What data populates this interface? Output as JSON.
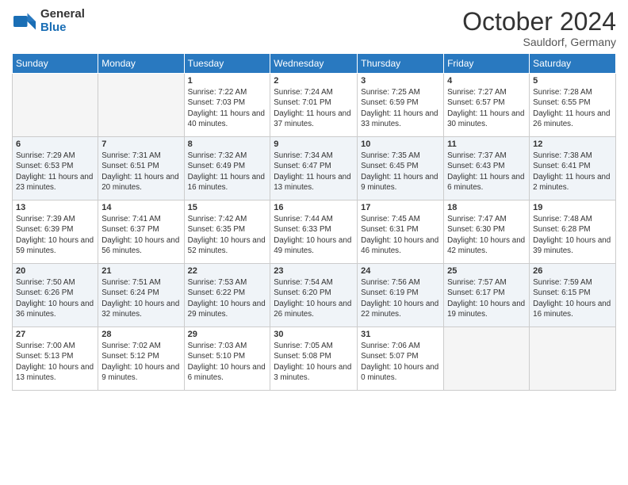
{
  "logo": {
    "general": "General",
    "blue": "Blue"
  },
  "header": {
    "month": "October 2024",
    "location": "Sauldorf, Germany"
  },
  "weekdays": [
    "Sunday",
    "Monday",
    "Tuesday",
    "Wednesday",
    "Thursday",
    "Friday",
    "Saturday"
  ],
  "weeks": [
    [
      {
        "day": "",
        "info": ""
      },
      {
        "day": "",
        "info": ""
      },
      {
        "day": "1",
        "info": "Sunrise: 7:22 AM\nSunset: 7:03 PM\nDaylight: 11 hours and 40 minutes."
      },
      {
        "day": "2",
        "info": "Sunrise: 7:24 AM\nSunset: 7:01 PM\nDaylight: 11 hours and 37 minutes."
      },
      {
        "day": "3",
        "info": "Sunrise: 7:25 AM\nSunset: 6:59 PM\nDaylight: 11 hours and 33 minutes."
      },
      {
        "day": "4",
        "info": "Sunrise: 7:27 AM\nSunset: 6:57 PM\nDaylight: 11 hours and 30 minutes."
      },
      {
        "day": "5",
        "info": "Sunrise: 7:28 AM\nSunset: 6:55 PM\nDaylight: 11 hours and 26 minutes."
      }
    ],
    [
      {
        "day": "6",
        "info": "Sunrise: 7:29 AM\nSunset: 6:53 PM\nDaylight: 11 hours and 23 minutes."
      },
      {
        "day": "7",
        "info": "Sunrise: 7:31 AM\nSunset: 6:51 PM\nDaylight: 11 hours and 20 minutes."
      },
      {
        "day": "8",
        "info": "Sunrise: 7:32 AM\nSunset: 6:49 PM\nDaylight: 11 hours and 16 minutes."
      },
      {
        "day": "9",
        "info": "Sunrise: 7:34 AM\nSunset: 6:47 PM\nDaylight: 11 hours and 13 minutes."
      },
      {
        "day": "10",
        "info": "Sunrise: 7:35 AM\nSunset: 6:45 PM\nDaylight: 11 hours and 9 minutes."
      },
      {
        "day": "11",
        "info": "Sunrise: 7:37 AM\nSunset: 6:43 PM\nDaylight: 11 hours and 6 minutes."
      },
      {
        "day": "12",
        "info": "Sunrise: 7:38 AM\nSunset: 6:41 PM\nDaylight: 11 hours and 2 minutes."
      }
    ],
    [
      {
        "day": "13",
        "info": "Sunrise: 7:39 AM\nSunset: 6:39 PM\nDaylight: 10 hours and 59 minutes."
      },
      {
        "day": "14",
        "info": "Sunrise: 7:41 AM\nSunset: 6:37 PM\nDaylight: 10 hours and 56 minutes."
      },
      {
        "day": "15",
        "info": "Sunrise: 7:42 AM\nSunset: 6:35 PM\nDaylight: 10 hours and 52 minutes."
      },
      {
        "day": "16",
        "info": "Sunrise: 7:44 AM\nSunset: 6:33 PM\nDaylight: 10 hours and 49 minutes."
      },
      {
        "day": "17",
        "info": "Sunrise: 7:45 AM\nSunset: 6:31 PM\nDaylight: 10 hours and 46 minutes."
      },
      {
        "day": "18",
        "info": "Sunrise: 7:47 AM\nSunset: 6:30 PM\nDaylight: 10 hours and 42 minutes."
      },
      {
        "day": "19",
        "info": "Sunrise: 7:48 AM\nSunset: 6:28 PM\nDaylight: 10 hours and 39 minutes."
      }
    ],
    [
      {
        "day": "20",
        "info": "Sunrise: 7:50 AM\nSunset: 6:26 PM\nDaylight: 10 hours and 36 minutes."
      },
      {
        "day": "21",
        "info": "Sunrise: 7:51 AM\nSunset: 6:24 PM\nDaylight: 10 hours and 32 minutes."
      },
      {
        "day": "22",
        "info": "Sunrise: 7:53 AM\nSunset: 6:22 PM\nDaylight: 10 hours and 29 minutes."
      },
      {
        "day": "23",
        "info": "Sunrise: 7:54 AM\nSunset: 6:20 PM\nDaylight: 10 hours and 26 minutes."
      },
      {
        "day": "24",
        "info": "Sunrise: 7:56 AM\nSunset: 6:19 PM\nDaylight: 10 hours and 22 minutes."
      },
      {
        "day": "25",
        "info": "Sunrise: 7:57 AM\nSunset: 6:17 PM\nDaylight: 10 hours and 19 minutes."
      },
      {
        "day": "26",
        "info": "Sunrise: 7:59 AM\nSunset: 6:15 PM\nDaylight: 10 hours and 16 minutes."
      }
    ],
    [
      {
        "day": "27",
        "info": "Sunrise: 7:00 AM\nSunset: 5:13 PM\nDaylight: 10 hours and 13 minutes."
      },
      {
        "day": "28",
        "info": "Sunrise: 7:02 AM\nSunset: 5:12 PM\nDaylight: 10 hours and 9 minutes."
      },
      {
        "day": "29",
        "info": "Sunrise: 7:03 AM\nSunset: 5:10 PM\nDaylight: 10 hours and 6 minutes."
      },
      {
        "day": "30",
        "info": "Sunrise: 7:05 AM\nSunset: 5:08 PM\nDaylight: 10 hours and 3 minutes."
      },
      {
        "day": "31",
        "info": "Sunrise: 7:06 AM\nSunset: 5:07 PM\nDaylight: 10 hours and 0 minutes."
      },
      {
        "day": "",
        "info": ""
      },
      {
        "day": "",
        "info": ""
      }
    ]
  ]
}
